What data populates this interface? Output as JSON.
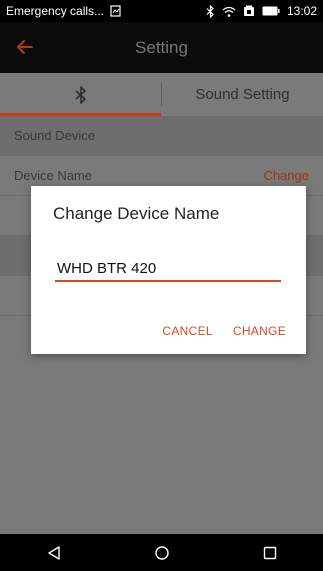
{
  "status_bar": {
    "left_text": "Emergency calls...",
    "time": "13:02",
    "icons": [
      "sim-card-icon",
      "bluetooth-icon",
      "wifi-icon",
      "battery-saver-icon",
      "battery-icon"
    ]
  },
  "app_bar": {
    "title": "Setting",
    "back_icon": "back-arrow-icon",
    "accent_color": "#d44a23"
  },
  "tabs": [
    {
      "label": "",
      "icon": "bluetooth-icon",
      "active": true
    },
    {
      "label": "Sound Setting",
      "active": false
    }
  ],
  "list": {
    "section_header": "Sound Device",
    "device_name_label": "Device Name",
    "device_name_action": "Change"
  },
  "dialog": {
    "title": "Change Device Name",
    "input_value": "WHD BTR 420",
    "cancel_label": "CANCEL",
    "confirm_label": "CHANGE"
  },
  "nav_bar": {
    "icons": [
      "back-triangle-icon",
      "home-circle-icon",
      "recents-square-icon"
    ]
  }
}
